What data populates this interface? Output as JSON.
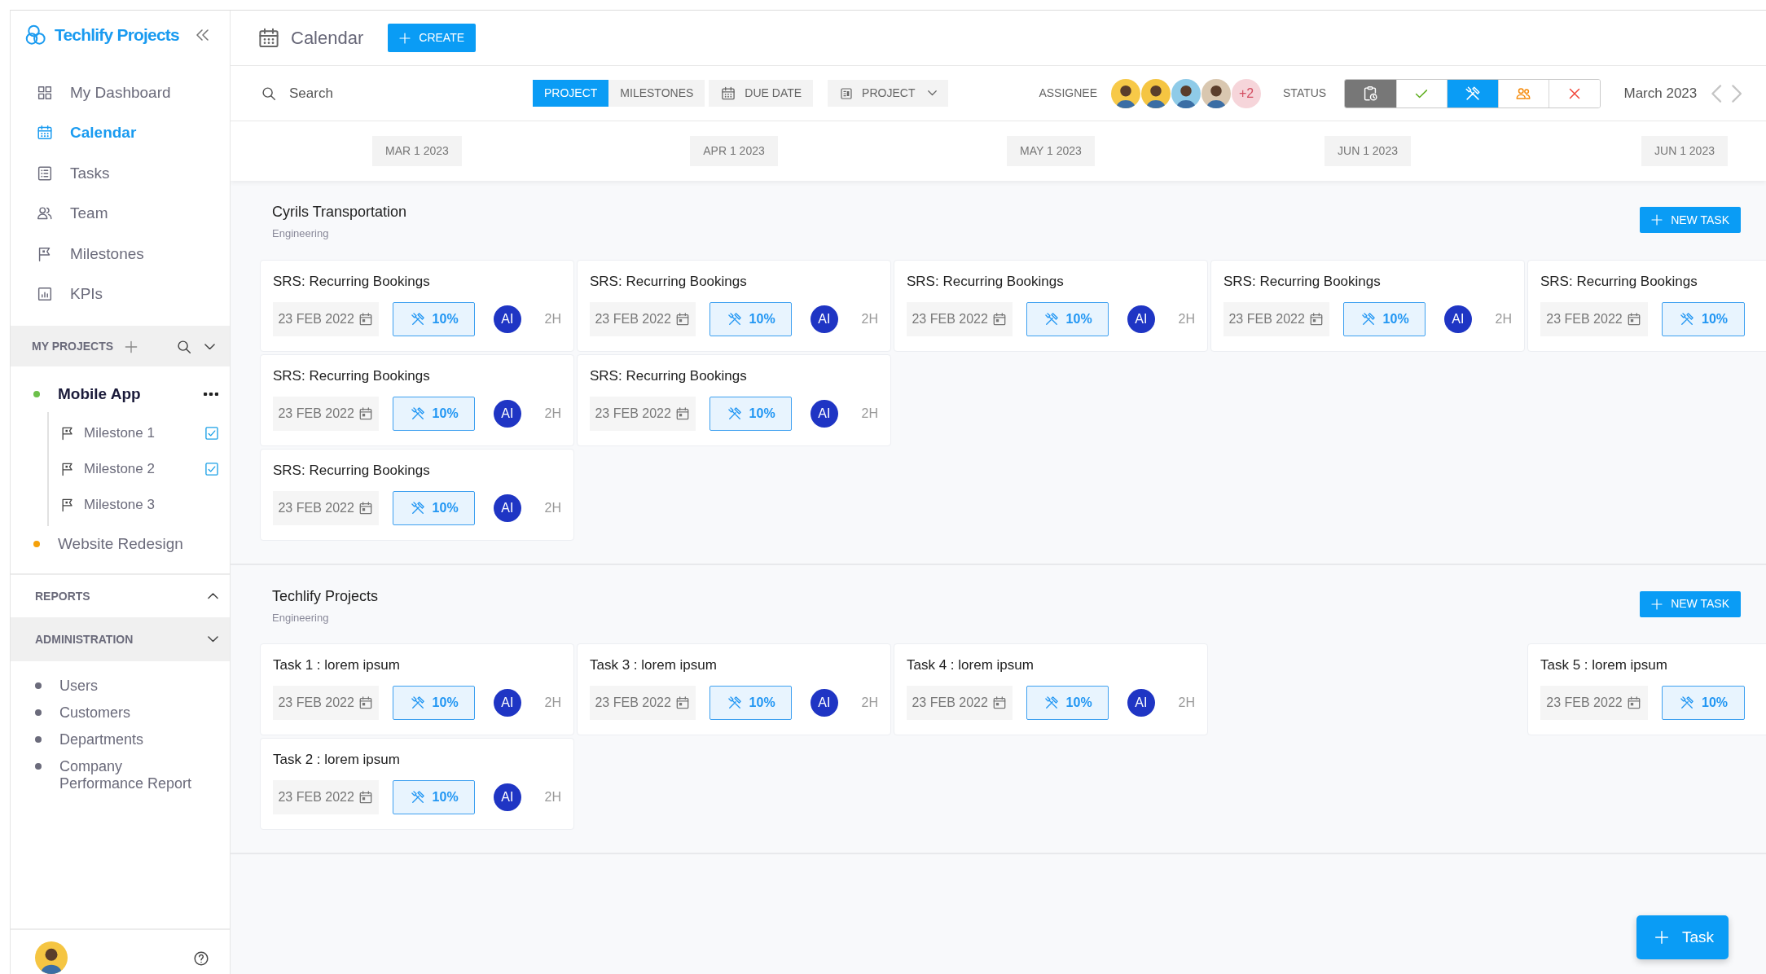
{
  "sidebar": {
    "brand": "Techlify Projects",
    "nav": [
      {
        "label": "My Dashboard",
        "selected": false
      },
      {
        "label": "Calendar",
        "selected": true
      },
      {
        "label": "Tasks",
        "selected": false
      },
      {
        "label": "Team",
        "selected": false
      },
      {
        "label": "Milestones",
        "selected": false
      },
      {
        "label": "KPIs",
        "selected": false
      }
    ],
    "projects_title": "MY PROJECTS",
    "projects": [
      {
        "name": "Mobile App",
        "color": "#6cc04a",
        "selected": true,
        "children": [
          {
            "name": "Milestone 1",
            "checked": true
          },
          {
            "name": "Milestone 2",
            "checked": true
          },
          {
            "name": "Milestone 3",
            "checked": false
          }
        ]
      },
      {
        "name": "Website Redesign",
        "color": "#f5a10a",
        "selected": false
      }
    ],
    "groups": [
      {
        "title": "REPORTS",
        "expanded": true,
        "selected": false
      },
      {
        "title": "ADMINISTRATION",
        "expanded": false,
        "selected": true,
        "children": [
          {
            "label": "Users"
          },
          {
            "label": "Customers"
          },
          {
            "label": "Departments"
          },
          {
            "label": "Company Performance Report"
          }
        ]
      }
    ]
  },
  "header": {
    "title": "Calendar",
    "create_button": "CREATE"
  },
  "toolbar": {
    "search": {
      "placeholder": "Search"
    },
    "view_tabs": [
      {
        "label": "PROJECT",
        "selected": true
      },
      {
        "label": "MILESTONES",
        "selected": false
      }
    ],
    "due_date": "DUE DATE",
    "group_by": "PROJECT",
    "assignee_label": "ASSIGNEE",
    "assignees": [
      {
        "color": "#f7c948"
      },
      {
        "color": "#f5c542"
      },
      {
        "color": "#8fcbe8"
      },
      {
        "color": "#d9c7b0"
      }
    ],
    "assignees_more": "+2",
    "status_label": "STATUS",
    "status_filters": [
      {
        "color": "#777777",
        "selected": true
      },
      {
        "color": "#5fae1f",
        "selected": false
      },
      {
        "color": "#0a9cf5",
        "selected": true
      },
      {
        "color": "#f58a0a",
        "selected": false
      },
      {
        "color": "#f04438",
        "selected": false
      }
    ],
    "month": "March 2023"
  },
  "timeline": {
    "dates": [
      "MAR 1 2023",
      "APR 1 2023",
      "MAY 1 2023",
      "JUN 1 2023",
      "JUN 1 2023"
    ]
  },
  "sections": [
    {
      "title": "Cyrils Transportation",
      "subtitle": "Engineering",
      "new_task_button": "NEW TASK",
      "rows": [
        [
          {
            "title": "SRS: Recurring Bookings",
            "due_date": "23 FEB 2022",
            "progress": "10%",
            "assignee": "AI",
            "hours": "2H"
          },
          {
            "title": "SRS: Recurring Bookings",
            "due_date": "23 FEB 2022",
            "progress": "10%",
            "assignee": "AI",
            "hours": "2H"
          },
          {
            "title": "SRS: Recurring Bookings",
            "due_date": "23 FEB 2022",
            "progress": "10%",
            "assignee": "AI",
            "hours": "2H"
          },
          {
            "title": "SRS: Recurring Bookings",
            "due_date": "23 FEB 2022",
            "progress": "10%",
            "assignee": "AI",
            "hours": "2H"
          },
          {
            "title": "SRS: Recurring Bookings",
            "due_date": "23 FEB 2022",
            "progress": "10%"
          }
        ],
        [
          {
            "title": "SRS: Recurring Bookings",
            "due_date": "23 FEB 2022",
            "progress": "10%",
            "assignee": "AI",
            "hours": "2H"
          },
          {
            "title": "SRS: Recurring Bookings",
            "due_date": "23 FEB 2022",
            "progress": "10%",
            "assignee": "AI",
            "hours": "2H"
          },
          null,
          null,
          null
        ],
        [
          {
            "title": "SRS: Recurring Bookings",
            "due_date": "23 FEB 2022",
            "progress": "10%",
            "assignee": "AI",
            "hours": "2H"
          },
          null,
          null,
          null,
          null
        ]
      ]
    },
    {
      "title": "Techlify Projects",
      "subtitle": "Engineering",
      "new_task_button": "NEW TASK",
      "rows": [
        [
          {
            "title": "Task 1 : lorem ipsum",
            "due_date": "23 FEB 2022",
            "progress": "10%",
            "assignee": "AI",
            "hours": "2H"
          },
          {
            "title": "Task 3 : lorem ipsum",
            "due_date": "23 FEB 2022",
            "progress": "10%",
            "assignee": "AI",
            "hours": "2H"
          },
          {
            "title": "Task 4 : lorem ipsum",
            "due_date": "23 FEB 2022",
            "progress": "10%",
            "assignee": "AI",
            "hours": "2H"
          },
          null,
          {
            "title": "Task 5 : lorem ipsum",
            "due_date": "23 FEB 2022",
            "progress": "10%"
          }
        ],
        [
          {
            "title": "Task 2 : lorem ipsum",
            "due_date": "23 FEB 2022",
            "progress": "10%",
            "assignee": "AI",
            "hours": "2H"
          },
          null,
          null,
          null,
          null
        ]
      ]
    }
  ],
  "fab": "Task"
}
